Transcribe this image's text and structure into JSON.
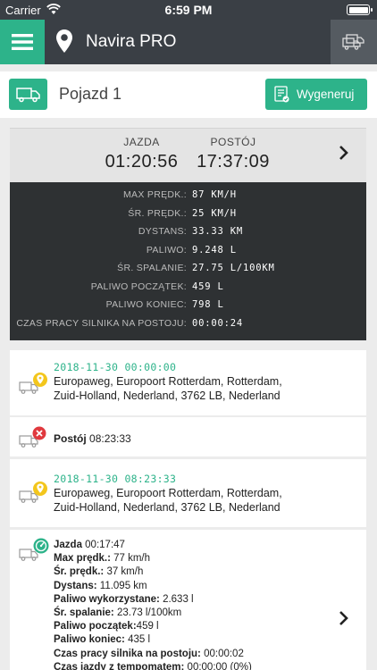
{
  "status": {
    "carrier": "Carrier",
    "time": "6:59 PM"
  },
  "header": {
    "title": "Navira PRO"
  },
  "vehicle": {
    "name": "Pojazd 1",
    "generate_label": "Wygeneruj"
  },
  "summary": {
    "drive_label": "JAZDA",
    "drive_time": "01:20:56",
    "stop_label": "POSTÓJ",
    "stop_time": "17:37:09"
  },
  "stats": [
    {
      "label": "MAX PRĘDK.:",
      "value": "87 KM/H"
    },
    {
      "label": "ŚR. PRĘDK.:",
      "value": "25 KM/H"
    },
    {
      "label": "DYSTANS:",
      "value": "33.33 KM"
    },
    {
      "label": "PALIWO:",
      "value": "9.248 L"
    },
    {
      "label": "ŚR. SPALANIE:",
      "value": "27.75 L/100KM"
    },
    {
      "label": "PALIWO POCZĄTEK:",
      "value": "459 L"
    },
    {
      "label": "PALIWO KONIEC:",
      "value": "798 L"
    },
    {
      "label": "CZAS PRACY SILNIKA NA POSTOJU:",
      "value": "00:00:24"
    }
  ],
  "timeline": {
    "item1": {
      "timestamp": "2018-11-30 00:00:00",
      "address": "Europaweg, Europoort Rotterdam, Rotterdam, Zuid-Holland, Nederland, 3762 LB, Nederland"
    },
    "item2": {
      "label": "Postój",
      "duration": "08:23:33"
    },
    "item3": {
      "timestamp": "2018-11-30 08:23:33",
      "address": "Europaweg, Europoort Rotterdam, Rotterdam, Zuid-Holland, Nederland, 3762 LB, Nederland"
    },
    "item4": {
      "lines": [
        {
          "label": "Jazda",
          "value": " 00:17:47"
        },
        {
          "label": "Max prędk.:",
          "value": " 77 km/h"
        },
        {
          "label": "Śr. prędk.:",
          "value": " 37 km/h"
        },
        {
          "label": "Dystans:",
          "value": " 11.095 km"
        },
        {
          "label": "Paliwo wykorzystane:",
          "value": " 2.633 l"
        },
        {
          "label": "Śr. spalanie:",
          "value": " 23.73 l/100km"
        },
        {
          "label": "Paliwo początek:",
          "value": "459 l"
        },
        {
          "label": "Paliwo koniec:",
          "value": " 435 l"
        },
        {
          "label": "Czas pracy silnika na postoju:",
          "value": " 00:00:02"
        },
        {
          "label": "Czas jazdy z tempomatem:",
          "value": " 00:00:00 (0%)"
        }
      ]
    }
  },
  "colors": {
    "accent": "#2db38a",
    "header": "#3a3f45",
    "stats_bg": "#2e3133",
    "stop_red": "#e0393e",
    "pin_yellow": "#f3c61c"
  }
}
